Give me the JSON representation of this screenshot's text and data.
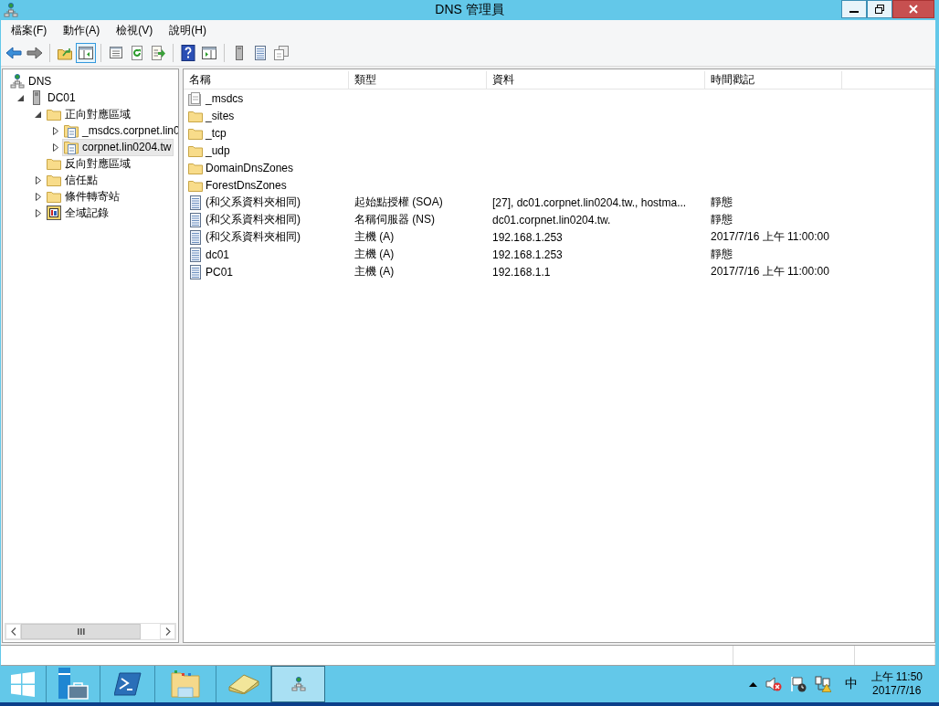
{
  "window": {
    "title": "DNS 管理員"
  },
  "menu": [
    "檔案(F)",
    "動作(A)",
    "檢視(V)",
    "說明(H)"
  ],
  "toolbar_groups": [
    {
      "buttons": [
        {
          "kind": "back",
          "pressed": false
        },
        {
          "kind": "forward",
          "pressed": false
        }
      ]
    },
    {
      "buttons": [
        {
          "kind": "up",
          "pressed": false
        },
        {
          "kind": "console-tree",
          "pressed": true
        }
      ]
    },
    {
      "buttons": [
        {
          "kind": "properties",
          "pressed": false
        },
        {
          "kind": "refresh",
          "pressed": false
        },
        {
          "kind": "export",
          "pressed": false
        }
      ]
    },
    {
      "buttons": [
        {
          "kind": "help",
          "pressed": false
        },
        {
          "kind": "action-pane",
          "pressed": false
        }
      ]
    },
    {
      "buttons": [
        {
          "kind": "server",
          "pressed": false
        },
        {
          "kind": "list",
          "pressed": false
        },
        {
          "kind": "copy",
          "pressed": false
        }
      ]
    }
  ],
  "tree": [
    {
      "label": "DNS",
      "kind": "dns",
      "selected": false,
      "children": [
        {
          "label": "DC01",
          "kind": "server",
          "expandable": true,
          "expanded": true,
          "selected": false,
          "children": [
            {
              "label": "正向對應區域",
              "kind": "folder",
              "expandable": true,
              "expanded": true,
              "selected": false,
              "children": [
                {
                  "label": "_msdcs.corpnet.lin0",
                  "kind": "zone",
                  "expandable": true,
                  "expanded": false,
                  "selected": false
                },
                {
                  "label": "corpnet.lin0204.tw",
                  "kind": "zone",
                  "expandable": true,
                  "expanded": false,
                  "selected": true
                }
              ]
            },
            {
              "label": "反向對應區域",
              "kind": "folder",
              "expandable": false,
              "expanded": false,
              "selected": false
            },
            {
              "label": "信任點",
              "kind": "folder",
              "expandable": true,
              "expanded": false,
              "selected": false
            },
            {
              "label": "條件轉寄站",
              "kind": "folder",
              "expandable": true,
              "expanded": false,
              "selected": false
            },
            {
              "label": "全域記錄",
              "kind": "log",
              "expandable": true,
              "expanded": false,
              "selected": false
            }
          ]
        }
      ]
    }
  ],
  "table": {
    "columns": [
      "名稱",
      "類型",
      "資料",
      "時間戳記"
    ],
    "rows": [
      {
        "kind": "delegation",
        "name": "_msdcs"
      },
      {
        "kind": "folder",
        "name": "_sites"
      },
      {
        "kind": "folder",
        "name": "_tcp"
      },
      {
        "kind": "folder",
        "name": "_udp"
      },
      {
        "kind": "folder",
        "name": "DomainDnsZones"
      },
      {
        "kind": "folder",
        "name": "ForestDnsZones"
      },
      {
        "kind": "record",
        "name": "(和父系資料夾相同)",
        "type": "起始點授權 (SOA)",
        "data": "[27], dc01.corpnet.lin0204.tw., hostma...",
        "timestamp": "靜態"
      },
      {
        "kind": "record",
        "name": "(和父系資料夾相同)",
        "type": "名稱伺服器 (NS)",
        "data": "dc01.corpnet.lin0204.tw.",
        "timestamp": "靜態"
      },
      {
        "kind": "record",
        "name": "(和父系資料夾相同)",
        "type": "主機 (A)",
        "data": "192.168.1.253",
        "timestamp": "2017/7/16 上午 11:00:00"
      },
      {
        "kind": "record",
        "name": "dc01",
        "type": "主機 (A)",
        "data": "192.168.1.253",
        "timestamp": "靜態"
      },
      {
        "kind": "record",
        "name": "PC01",
        "type": "主機 (A)",
        "data": "192.168.1.1",
        "timestamp": "2017/7/16 上午 11:00:00"
      }
    ]
  },
  "taskbar": {
    "apps": [
      {
        "kind": "start",
        "active": false
      },
      {
        "kind": "server-manager",
        "active": false
      },
      {
        "kind": "powershell",
        "active": false
      },
      {
        "kind": "explorer",
        "active": false
      },
      {
        "kind": "tools",
        "active": false
      },
      {
        "kind": "dns",
        "active": true
      }
    ],
    "tray_icons": [
      {
        "kind": "chevron"
      },
      {
        "kind": "volume-muted"
      },
      {
        "kind": "flag"
      },
      {
        "kind": "network-warning"
      }
    ],
    "ime": "中",
    "time": "上午 11:50",
    "date": "2017/7/16"
  }
}
